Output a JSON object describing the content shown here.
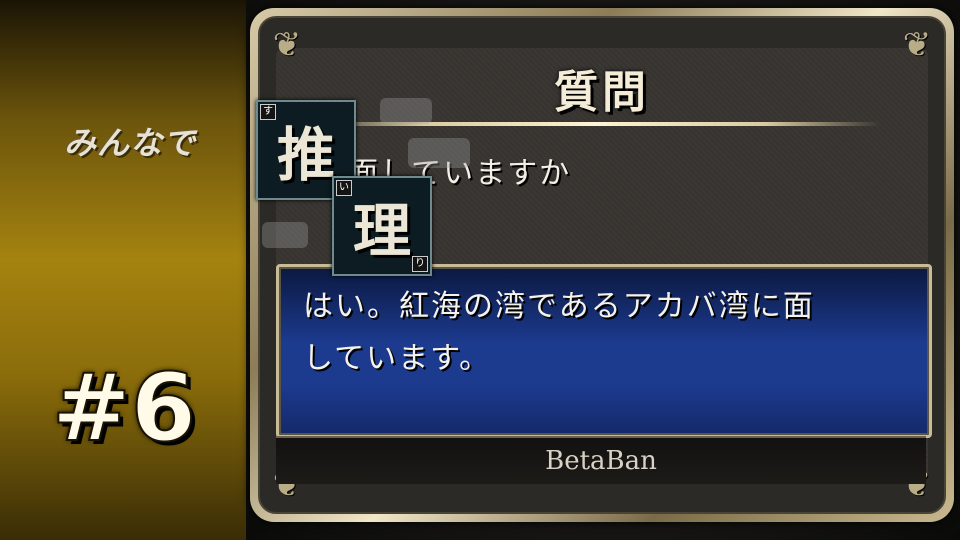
{
  "series_title": "みんなで",
  "logo_kanji": [
    {
      "main": "推",
      "ruby": "す"
    },
    {
      "main": "理",
      "ruby_top": "い",
      "ruby_bottom": "り"
    }
  ],
  "episode": "#6",
  "dialog": {
    "title": "質問",
    "question": "海に面していますか",
    "answer_lines": [
      "はい。紅海の湾であるアカバ湾に面",
      "しています。"
    ],
    "footer_name": "BetaBan"
  },
  "colors": {
    "gold_strip": "#a58310",
    "frame_gold": "#d8cba8",
    "answer_blue": "#1c3a8e",
    "panel_dark": "#3b3834"
  },
  "icons": {
    "corner_ornament": "flourish-icon"
  }
}
